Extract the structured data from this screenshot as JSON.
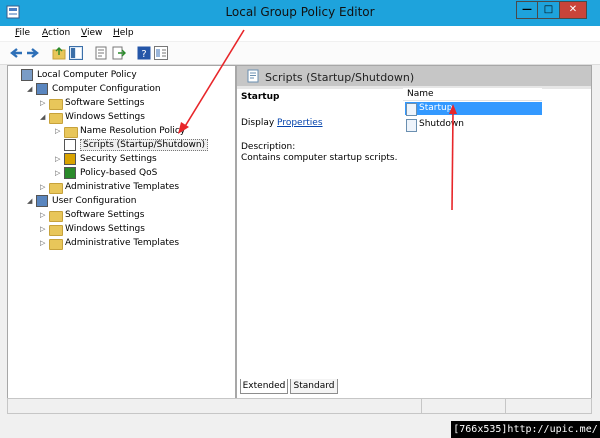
{
  "window": {
    "title": "Local Group Policy Editor",
    "controls": {
      "minimize": "—",
      "maximize": "□",
      "close": "✕"
    }
  },
  "menu": [
    {
      "key": "F",
      "rest": "ile"
    },
    {
      "key": "A",
      "rest": "ction"
    },
    {
      "key": "V",
      "rest": "iew"
    },
    {
      "key": "H",
      "rest": "elp"
    }
  ],
  "toolbar_icons": [
    "back-icon",
    "forward-icon",
    "up-folder-icon",
    "show-hide-tree-icon",
    "properties-icon",
    "export-list-icon",
    "help-icon",
    "extended-view-icon"
  ],
  "tree": [
    {
      "label": "Local Computer Policy",
      "indent": 0,
      "arrow": "",
      "icon": "computer-policy-icon"
    },
    {
      "label": "Computer Configuration",
      "indent": 1,
      "arrow": "◢",
      "icon": "computer-icon"
    },
    {
      "label": "Software Settings",
      "indent": 2,
      "arrow": "▷",
      "icon": "folder-icon"
    },
    {
      "label": "Windows Settings",
      "indent": 2,
      "arrow": "◢",
      "icon": "folder-icon"
    },
    {
      "label": "Name Resolution Policy",
      "indent": 3,
      "arrow": "▷",
      "icon": "folder-icon"
    },
    {
      "label": "Scripts (Startup/Shutdown)",
      "indent": 3,
      "arrow": "",
      "icon": "scripts-icon",
      "selected": true
    },
    {
      "label": "Security Settings",
      "indent": 3,
      "arrow": "▷",
      "icon": "security-icon"
    },
    {
      "label": "Policy-based QoS",
      "indent": 3,
      "arrow": "▷",
      "icon": "qos-chart-icon"
    },
    {
      "label": "Administrative Templates",
      "indent": 2,
      "arrow": "▷",
      "icon": "folder-icon"
    },
    {
      "label": "User Configuration",
      "indent": 1,
      "arrow": "◢",
      "icon": "user-icon"
    },
    {
      "label": "Software Settings",
      "indent": 2,
      "arrow": "▷",
      "icon": "folder-icon"
    },
    {
      "label": "Windows Settings",
      "indent": 2,
      "arrow": "▷",
      "icon": "folder-icon"
    },
    {
      "label": "Administrative Templates",
      "indent": 2,
      "arrow": "▷",
      "icon": "folder-icon"
    }
  ],
  "right_pane": {
    "header": "Scripts (Startup/Shutdown)",
    "extended": {
      "item_title": "Startup",
      "display_prefix": "Display ",
      "display_link": "Properties",
      "description_label": "Description:",
      "description_text": "Contains computer startup scripts."
    },
    "list": {
      "column_name": "Name",
      "items": [
        {
          "label": "Startup",
          "selected": true
        },
        {
          "label": "Shutdown",
          "selected": false
        }
      ]
    },
    "tabs": [
      "Extended",
      "Standard"
    ]
  },
  "watermark": "[766x535]http://upic.me/",
  "colors": {
    "titlebar": "#1ea3dc",
    "selection": "#3399ff",
    "annotation": "#e8262a",
    "link": "#0645ad"
  }
}
